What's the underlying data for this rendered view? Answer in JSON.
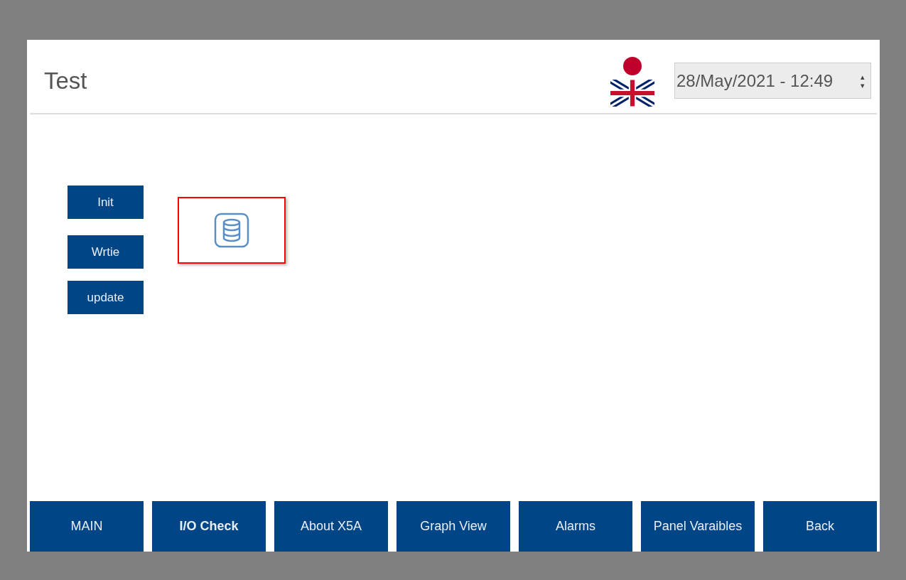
{
  "header": {
    "title": "Test",
    "datetime": "28/May/2021 - 12:49",
    "spinner": {
      "up": "▴",
      "down": "▾"
    }
  },
  "actions": [
    "Init",
    "Wrtie",
    "update"
  ],
  "nav": [
    {
      "label": "MAIN",
      "selected": false
    },
    {
      "label": "I/O Check",
      "selected": true
    },
    {
      "label": "About X5A",
      "selected": false
    },
    {
      "label": "Graph View",
      "selected": false
    },
    {
      "label": "Alarms",
      "selected": false
    },
    {
      "label": "Panel Varaibles",
      "selected": false
    },
    {
      "label": "Back",
      "selected": false
    }
  ]
}
